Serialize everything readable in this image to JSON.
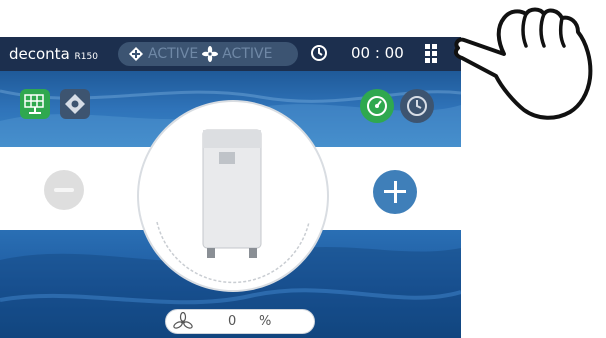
{
  "header": {
    "brand_name": "deconta",
    "brand_model": "R150",
    "status_1": "ACTIVE",
    "status_2": "ACTIVE",
    "time": "00 : 00",
    "status_icons": [
      "diamond-arrows-icon",
      "fan-icon"
    ],
    "clock_icon": "clock-icon",
    "menu_icon": "grid-menu-icon"
  },
  "toolbar": {
    "left_buttons": [
      "solar-panel-icon",
      "directional-arrows-icon"
    ],
    "right_buttons": [
      "gauge-icon",
      "timer-icon"
    ]
  },
  "controls": {
    "minus_icon": "minus-icon",
    "plus_icon": "plus-icon"
  },
  "device": {
    "image": "air-purifier-unit"
  },
  "fan": {
    "icon": "fan-icon",
    "value": "0",
    "unit": "%"
  },
  "overlay": {
    "icon": "pointing-hand-icon"
  },
  "colors": {
    "topbar": "#1c2f4e",
    "accent_blue": "#3f7fb9",
    "green_button": "#2fa84f",
    "dark_tile": "#3d5470",
    "minus_disabled": "#dedede"
  }
}
